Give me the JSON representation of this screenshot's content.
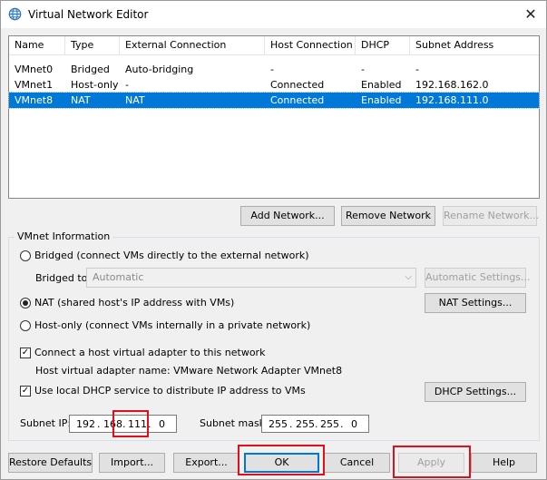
{
  "window": {
    "title": "Virtual Network Editor",
    "close": "✕"
  },
  "table": {
    "headers": [
      "Name",
      "Type",
      "External Connection",
      "Host Connection",
      "DHCP",
      "Subnet Address"
    ],
    "rows": [
      [
        "VMnet0",
        "Bridged",
        "Auto-bridging",
        "-",
        "-",
        "-"
      ],
      [
        "VMnet1",
        "Host-only",
        "-",
        "Connected",
        "Enabled",
        "192.168.162.0"
      ],
      [
        "VMnet8",
        "NAT",
        "NAT",
        "Connected",
        "Enabled",
        "192.168.111.0"
      ]
    ]
  },
  "network_buttons": {
    "add": "Add Network...",
    "remove": "Remove Network",
    "rename": "Rename Network..."
  },
  "vmnet_info": {
    "label": "VMnet Information",
    "bridged_label": "Bridged (connect VMs directly to the external network)",
    "bridged_to_label": "Bridged to:",
    "bridged_to_value": "Automatic",
    "auto_settings": "Automatic Settings...",
    "nat_label": "NAT (shared host's IP address with VMs)",
    "nat_settings": "NAT Settings...",
    "hostonly_label": "Host-only (connect VMs internally in a private network)",
    "connect_adapter_label": "Connect a host virtual adapter to this network",
    "adapter_name_label": "Host virtual adapter name: VMware Network Adapter VMnet8",
    "dhcp_label": "Use local DHCP service to distribute IP address to VMs",
    "dhcp_settings": "DHCP Settings...",
    "subnet_ip_label": "Subnet IP:",
    "subnet_ip": [
      "192",
      "168",
      "111",
      "0"
    ],
    "subnet_mask_label": "Subnet mask:",
    "subnet_mask": [
      "255",
      "255",
      "255",
      "0"
    ],
    "dot": "."
  },
  "bottom_buttons": {
    "restore": "Restore Defaults",
    "import": "Import...",
    "export": "Export...",
    "ok": "OK",
    "cancel": "Cancel",
    "apply": "Apply",
    "help": "Help"
  },
  "icons": {
    "title_icon": "globe-network-icon",
    "dropdown": "chevron-down-icon"
  },
  "colors": {
    "selection": "#0078d7",
    "highlight_box": "#e0101a"
  }
}
